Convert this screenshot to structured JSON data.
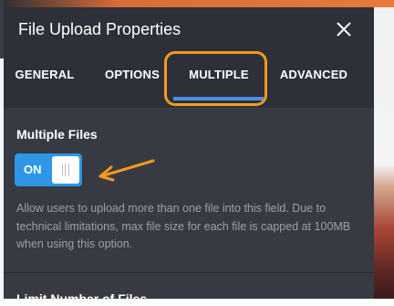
{
  "panel": {
    "title": "File Upload Properties"
  },
  "tabs": [
    {
      "label": "GENERAL"
    },
    {
      "label": "OPTIONS"
    },
    {
      "label": "MULTIPLE",
      "active": true
    },
    {
      "label": "ADVANCED"
    }
  ],
  "multiple_files": {
    "title": "Multiple Files",
    "toggle_label": "ON",
    "toggle_state": true,
    "description": "Allow users to upload more than one file into this field. Due to technical limitations, max file size for each file is capped at 100MB when using this option."
  },
  "next_section": {
    "title": "Limit Number of Files"
  },
  "colors": {
    "panel_bg": "#373a42",
    "header_bg": "#2d3038",
    "accent_blue": "#2d96e6",
    "annotation_orange": "#f39a1f"
  },
  "icons": {
    "close": "close-icon",
    "arrow": "arrow-icon"
  }
}
